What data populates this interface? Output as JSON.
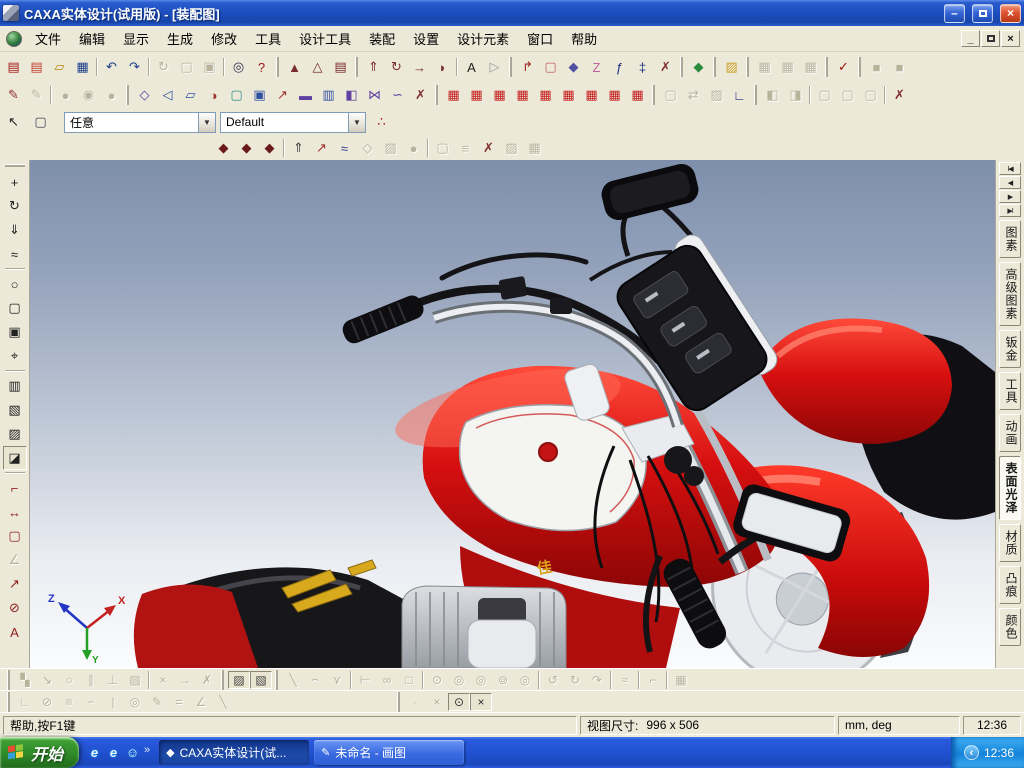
{
  "window": {
    "title": "CAXA实体设计(试用版) - [装配图]",
    "minimize_glyph": "–",
    "close_glyph": "×"
  },
  "menu_bar": {
    "items": [
      "文件",
      "编辑",
      "显示",
      "生成",
      "修改",
      "工具",
      "设计工具",
      "装配",
      "设置",
      "设计元素",
      "窗口",
      "帮助"
    ],
    "mdi_minimize": "_",
    "mdi_close": "×"
  },
  "selection_bar": {
    "filter_value": "任意",
    "style_value": "Default",
    "dropdown_glyph": "▼"
  },
  "toolbars": {
    "standard": [
      [
        "new-icon",
        "▤",
        "#a01818"
      ],
      [
        "new-template-icon",
        "▤",
        "#c04030"
      ],
      [
        "open-icon",
        "▱",
        "#b8860b"
      ],
      [
        "save-icon",
        "▦",
        "#1c3e8c"
      ],
      "|",
      [
        "undo-icon",
        "↶",
        "#1c3e8c"
      ],
      [
        "redo-icon",
        "↷",
        "#1c3e8c"
      ],
      "|",
      [
        "update-icon",
        "↻",
        "",
        "d"
      ],
      [
        "copy-icon",
        "▢",
        "",
        "d"
      ],
      [
        "ole-lock-icon",
        "▣",
        "",
        "d"
      ],
      "|",
      [
        "find-icon",
        "◎",
        "#333355"
      ],
      [
        "context-help-icon",
        "?",
        "#a01818"
      ],
      "g",
      [
        "smart-render-icon",
        "▲",
        "#7a2b2b"
      ],
      [
        "smart-dimension-icon",
        "△",
        "#7a2b2b"
      ],
      [
        "smart-print-icon",
        "▤",
        "#7a2b2b"
      ],
      "g",
      [
        "extrude-icon",
        "⇑",
        "#7a2b2b"
      ],
      [
        "revolve-icon",
        "↻",
        "#7a2b2b"
      ],
      [
        "sweep-icon",
        "→",
        "#7a2b2b"
      ],
      [
        "loft-icon",
        "◗",
        "#7a2b2b"
      ],
      "|",
      [
        "text-wizard-icon",
        "A",
        "#222222"
      ],
      [
        "flag-icon",
        "▷",
        "#999999"
      ],
      "g",
      [
        "bend-icon",
        "↱",
        "#a02020"
      ],
      [
        "shape-copy-icon",
        "▢",
        "#c06060"
      ],
      [
        "pattern-icon",
        "◆",
        "#5050a0"
      ],
      [
        "section-icon",
        "Z",
        "#c060a0"
      ],
      [
        "function-icon",
        "ƒ",
        "#203080"
      ],
      [
        "constraint-icon",
        "‡",
        "#203080"
      ],
      [
        "suppress-icon",
        "✗",
        "#803030"
      ],
      "g",
      [
        "facet-icon",
        "◆",
        "#2b8a3e"
      ],
      "g",
      [
        "folder-lock-icon",
        "▨",
        "#c9a227"
      ],
      "g",
      [
        "grid-1-icon",
        "▦",
        "",
        "d"
      ],
      [
        "grid-2-icon",
        "▦",
        "",
        "d"
      ],
      [
        "grid-3-icon",
        "▦",
        "",
        "d"
      ],
      "g",
      [
        "validate-icon",
        "✓",
        "#a01010"
      ],
      "g",
      [
        "panel-1-icon",
        "■",
        "",
        "d"
      ],
      [
        "panel-2-icon",
        "■",
        "",
        "d"
      ]
    ],
    "feature": [
      [
        "sketch-icon",
        "✎",
        "#903030"
      ],
      [
        "sketch-edit-icon",
        "✎",
        "",
        "d"
      ],
      "|",
      [
        "spray-1-icon",
        "●",
        "",
        "d"
      ],
      [
        "spray-2-icon",
        "◉",
        "",
        "d"
      ],
      [
        "spray-3-icon",
        "●",
        "",
        "d"
      ],
      "g",
      [
        "cage-icon",
        "◇",
        "#6040a0"
      ],
      [
        "knife-icon",
        "◁",
        "#3050a0"
      ],
      [
        "patch-icon",
        "▱",
        "#3050a0"
      ],
      [
        "pot-icon",
        "◑",
        "#a03030"
      ],
      [
        "trim-icon",
        "▢",
        "#309090"
      ],
      [
        "box-icon",
        "▣",
        "#3050a0"
      ],
      [
        "arrow-mod-icon",
        "↗",
        "#a03030"
      ],
      [
        "plane-icon",
        "▬",
        "#6040a0"
      ],
      [
        "rib-icon",
        "▥",
        "#3050a0"
      ],
      [
        "mirror-icon",
        "◧",
        "#6040a0"
      ],
      [
        "wing-icon",
        "⋈",
        "#6040a0"
      ],
      [
        "twist-icon",
        "∽",
        "#6040a0"
      ],
      [
        "remove-face-icon",
        "✗",
        "#803030"
      ],
      "g",
      [
        "cube-1-icon",
        "▦",
        "#c41c1c"
      ],
      [
        "cube-2-icon",
        "▦",
        "#c41c1c"
      ],
      [
        "cube-3-icon",
        "▦",
        "#c41c1c"
      ],
      [
        "cube-4-icon",
        "▦",
        "#c41c1c"
      ],
      [
        "cube-5-icon",
        "▦",
        "#c41c1c"
      ],
      [
        "cube-6-icon",
        "▦",
        "#c41c1c"
      ],
      [
        "cube-7-icon",
        "▦",
        "#c41c1c"
      ],
      [
        "cube-8-icon",
        "▦",
        "#c41c1c"
      ],
      [
        "cube-9-icon",
        "▦",
        "#c41c1c"
      ],
      "g",
      [
        "fillet-icon",
        "▢",
        "",
        "d"
      ],
      [
        "swap-icon",
        "⇄",
        "",
        "d"
      ],
      [
        "shade-icon",
        "▨",
        "",
        "d"
      ],
      [
        "corner-icon",
        "∟",
        "#203080"
      ],
      "g",
      [
        "half-1-icon",
        "◧",
        "",
        "d"
      ],
      [
        "half-2-icon",
        "◨",
        "",
        "d"
      ],
      "|",
      [
        "doc-1-icon",
        "▢",
        "",
        "d"
      ],
      [
        "doc-2-icon",
        "▢",
        "",
        "d"
      ],
      [
        "doc-3-icon",
        "▢",
        "",
        "d"
      ],
      "|",
      [
        "no-snap-icon",
        "✗",
        "#803030"
      ]
    ],
    "assembly": [
      [
        "smart-motion-1-icon",
        "◆",
        "#6b1a1a"
      ],
      [
        "smart-motion-2-icon",
        "◆",
        "#6b1a1a"
      ],
      [
        "smart-motion-3-icon",
        "◆",
        "#6b1a1a"
      ],
      "|",
      [
        "insert-feature-icon",
        "⇑",
        "#444444"
      ],
      [
        "edit-feature-icon",
        "↗",
        "#a03030"
      ],
      [
        "spring-icon",
        "≈",
        "#304090"
      ],
      [
        "disabled-a-icon",
        "◇",
        "",
        "d"
      ],
      [
        "disabled-b-icon",
        "▨",
        "",
        "d"
      ],
      [
        "disabled-c-icon",
        "●",
        "",
        "d"
      ],
      "|",
      [
        "disabled-d-icon",
        "▢",
        "",
        "d"
      ],
      [
        "disabled-e-icon",
        "≡",
        "",
        "d"
      ],
      [
        "remove-tool-icon",
        "✗",
        "#803030"
      ],
      [
        "disabled-f-icon",
        "▨",
        "",
        "d"
      ],
      [
        "disabled-g-icon",
        "▦",
        "",
        "d"
      ]
    ],
    "left": [
      "g",
      [
        "pan-icon",
        "+",
        "#222222"
      ],
      [
        "rotate-view-icon",
        "↻",
        "#222222"
      ],
      [
        "fly-icon",
        "⇓",
        "#222222"
      ],
      [
        "walk-path-icon",
        "≈",
        "#222222"
      ],
      "|",
      [
        "zoom-icon",
        "○",
        "#222222"
      ],
      [
        "zoom-window-icon",
        "▢",
        "#222222"
      ],
      [
        "zoom-extents-icon",
        "▣",
        "#222222"
      ],
      [
        "target-view-icon",
        "⌖",
        "#222222"
      ],
      "|",
      [
        "display-mode-icon",
        "▥",
        "#222222"
      ],
      [
        "camera-icon",
        "▧",
        "#222222"
      ],
      [
        "camera-props-icon",
        "▨",
        "#222222"
      ],
      [
        "render-settings-icon",
        "◪",
        "#222222",
        "p"
      ],
      "|",
      [
        "edge-dim-icon",
        "⌐",
        "#902020"
      ],
      [
        "length-dim-icon",
        "↔",
        "#902020"
      ],
      [
        "rect-dim-icon",
        "▢",
        "#902020"
      ],
      [
        "angle-dim-icon",
        "∠",
        "",
        "d"
      ],
      [
        "arrow-dim-icon",
        "↗",
        "#902020"
      ],
      [
        "diameter-dim-icon",
        "⊘",
        "#902020"
      ],
      [
        "text-dim-icon",
        "A",
        "#902020"
      ]
    ],
    "bottom1": [
      "g",
      [
        "flow-icon",
        "▚",
        "",
        "d"
      ],
      [
        "scale-icon",
        "↘",
        "",
        "d"
      ],
      [
        "circle-tool-icon",
        "○",
        "",
        "d"
      ],
      [
        "angle-tool-icon",
        "∥",
        "",
        "d"
      ],
      [
        "vertex-icon",
        "⊥",
        "",
        "d"
      ],
      [
        "stamp-icon",
        "▨",
        "",
        "d"
      ],
      "|",
      [
        "delete-x-icon",
        "×",
        "",
        "d"
      ],
      [
        "arrow-right-icon",
        "→",
        "",
        "d"
      ],
      [
        "erase-tool-icon",
        "✗",
        "",
        "d"
      ],
      "g",
      [
        "sketch-2d-icon",
        "▨",
        "#444444",
        "p"
      ],
      [
        "sketch-3d-icon",
        "▧",
        "#444444",
        "p"
      ],
      "g",
      [
        "line-icon",
        "╲",
        "",
        "d"
      ],
      [
        "arc-icon",
        "⌢",
        "",
        "d"
      ],
      [
        "fork-icon",
        "⋎",
        "",
        "d"
      ],
      "|",
      [
        "coord-tool-icon",
        "⊢",
        "",
        "d"
      ],
      [
        "link-circles-icon",
        "∞",
        "",
        "d"
      ],
      [
        "rect-tool-icon",
        "□",
        "",
        "d"
      ],
      "|",
      [
        "circle-1-icon",
        "⊙",
        "",
        "d"
      ],
      [
        "circle-2-icon",
        "◎",
        "",
        "d"
      ],
      [
        "circle-3-icon",
        "◎",
        "",
        "d"
      ],
      [
        "circle-4-icon",
        "⊚",
        "",
        "d"
      ],
      [
        "circle-5-icon",
        "◎",
        "",
        "d"
      ],
      "|",
      [
        "spiral-1-icon",
        "↺",
        "",
        "d"
      ],
      [
        "spiral-2-icon",
        "↻",
        "",
        "d"
      ],
      [
        "spiral-3-icon",
        "↷",
        "",
        "d"
      ],
      "|",
      [
        "squiggle-icon",
        "≈",
        "",
        "d"
      ],
      "|",
      [
        "corner-tool-icon",
        "⌐",
        "",
        "d"
      ],
      "|",
      [
        "table-tool-icon",
        "▦",
        "",
        "d"
      ]
    ],
    "bottom2_left": [
      "g",
      [
        "perp-icon",
        "∟",
        "",
        "d"
      ],
      [
        "no-circle-icon",
        "⊘",
        "",
        "d"
      ],
      [
        "hatch-icon",
        "≡",
        "",
        "d"
      ],
      [
        "dash-icon",
        "−",
        "",
        "d"
      ],
      [
        "vbar-icon",
        "|",
        "",
        "d"
      ],
      [
        "concentric-icon",
        "◎",
        "",
        "d"
      ],
      [
        "pen-tool-icon",
        "✎",
        "",
        "d"
      ],
      [
        "parallel-icon",
        "=",
        "",
        "d"
      ],
      [
        "angle-mark-icon",
        "∠",
        "",
        "d"
      ],
      [
        "slash-icon",
        "╲",
        "",
        "d"
      ]
    ],
    "bottom2_right": [
      "g",
      [
        "point-icon",
        "·",
        "",
        "d"
      ],
      [
        "point-x-icon",
        "×",
        "",
        "d"
      ],
      [
        "point-circle-icon",
        "⊙",
        "#333333",
        "p"
      ],
      [
        "point-cross-icon",
        "×",
        "#333333",
        "p"
      ]
    ]
  },
  "right_panel": {
    "nav": [
      "I◀",
      "◀",
      "▶",
      "▶I"
    ],
    "tabs": [
      {
        "label": "图素",
        "active": false
      },
      {
        "label": "高级图素",
        "active": false
      },
      {
        "label": "钣金",
        "active": false
      },
      {
        "label": "工具",
        "active": false
      },
      {
        "label": "动画",
        "active": false
      },
      {
        "label": "表面光泽",
        "active": true
      },
      {
        "label": "材质",
        "active": false
      },
      {
        "label": "凸痕",
        "active": false
      },
      {
        "label": "颜色",
        "active": false
      }
    ]
  },
  "status_bar": {
    "help": "帮助,按F1键",
    "view_label": "视图尺寸:",
    "view_value": "996 x 506",
    "units": "mm, deg",
    "time": "12:36"
  },
  "taskbar": {
    "start": "开始",
    "quick": [
      {
        "n": "ie-icon",
        "g": "e"
      },
      {
        "n": "ie-channel-icon",
        "g": "e"
      },
      {
        "n": "assistant-icon",
        "g": "☺"
      }
    ],
    "overflow": "»",
    "tasks": [
      {
        "glyph": "◆",
        "label": "CAXA实体设计(试...",
        "active": true
      },
      {
        "glyph": "✎",
        "label": "未命名 - 画图",
        "active": false
      }
    ],
    "tray_chevron": "‹",
    "tray_time": "12:36"
  },
  "viewport": {
    "axes": {
      "x": "X",
      "y": "Y",
      "z": "Z"
    },
    "emblem": "佳"
  }
}
